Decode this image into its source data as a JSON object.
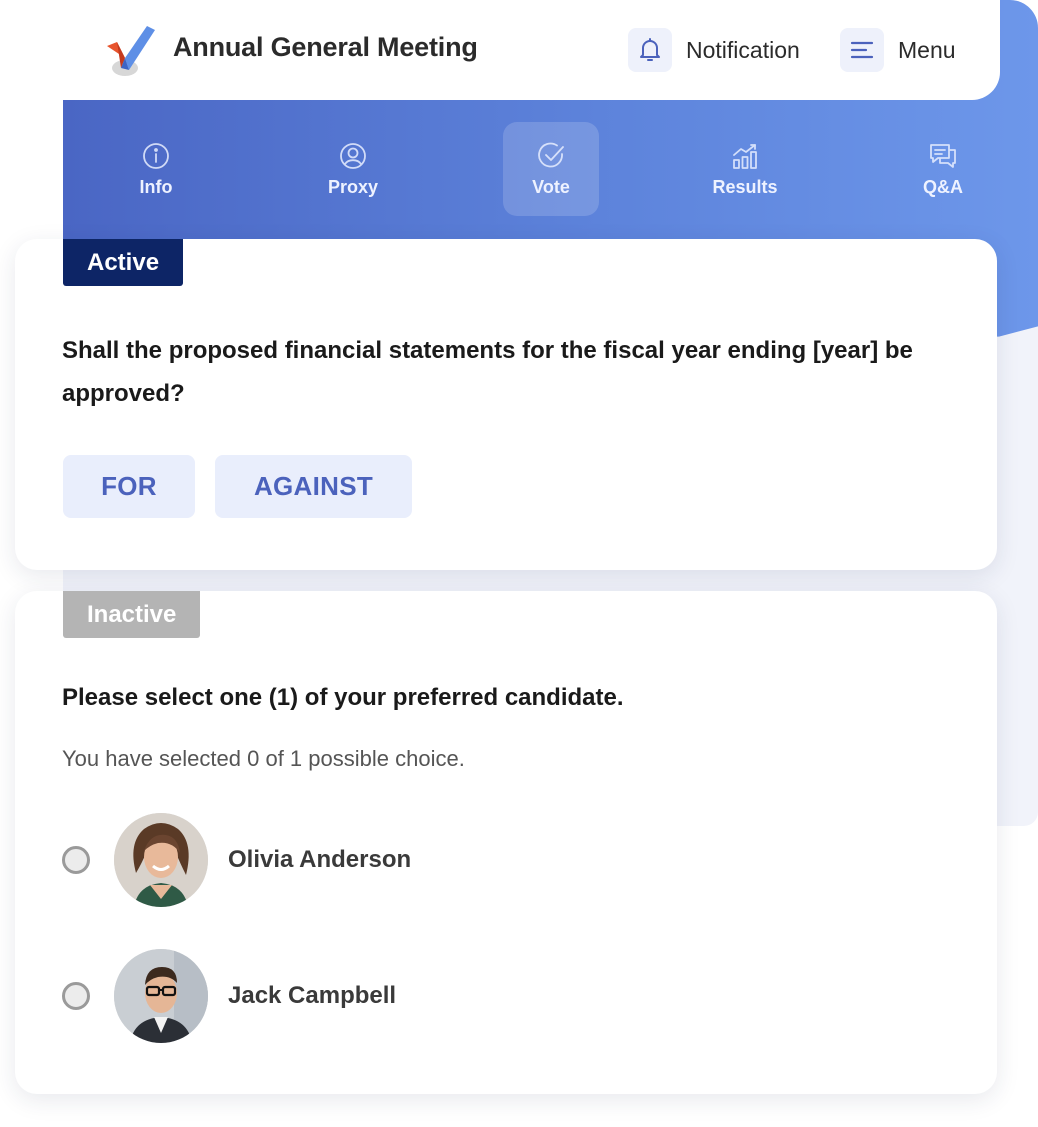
{
  "header": {
    "title": "Annual General Meeting",
    "logo_icon": "checkmark-logo",
    "notification_label": "Notification",
    "notification_icon": "bell-icon",
    "menu_label": "Menu",
    "menu_icon": "hamburger-icon"
  },
  "colors": {
    "accent_start": "#4a66c4",
    "accent_end": "#6d97ea",
    "active_tag": "#0d2566",
    "inactive_tag": "#b4b4b4",
    "vote_button_bg": "#e9eefc",
    "vote_button_text": "#4b62bc"
  },
  "nav": {
    "tabs": [
      {
        "label": "Info",
        "icon": "info-icon",
        "active": false
      },
      {
        "label": "Proxy",
        "icon": "user-circle-icon",
        "active": false
      },
      {
        "label": "Vote",
        "icon": "check-circle-icon",
        "active": true
      },
      {
        "label": "Results",
        "icon": "bar-chart-icon",
        "active": false
      },
      {
        "label": "Q&A",
        "icon": "chat-icon",
        "active": false
      }
    ]
  },
  "active_card": {
    "status": "Active",
    "question": "Shall the proposed financial statements for the fiscal year ending [year] be approved?",
    "options": [
      "FOR",
      "AGAINST"
    ]
  },
  "inactive_card": {
    "status": "Inactive",
    "question": "Please select one (1) of your preferred candidate.",
    "selection_info": "You have selected 0 of 1 possible choice.",
    "candidates": [
      {
        "name": "Olivia Anderson",
        "selected": false
      },
      {
        "name": "Jack Campbell",
        "selected": false
      }
    ]
  }
}
